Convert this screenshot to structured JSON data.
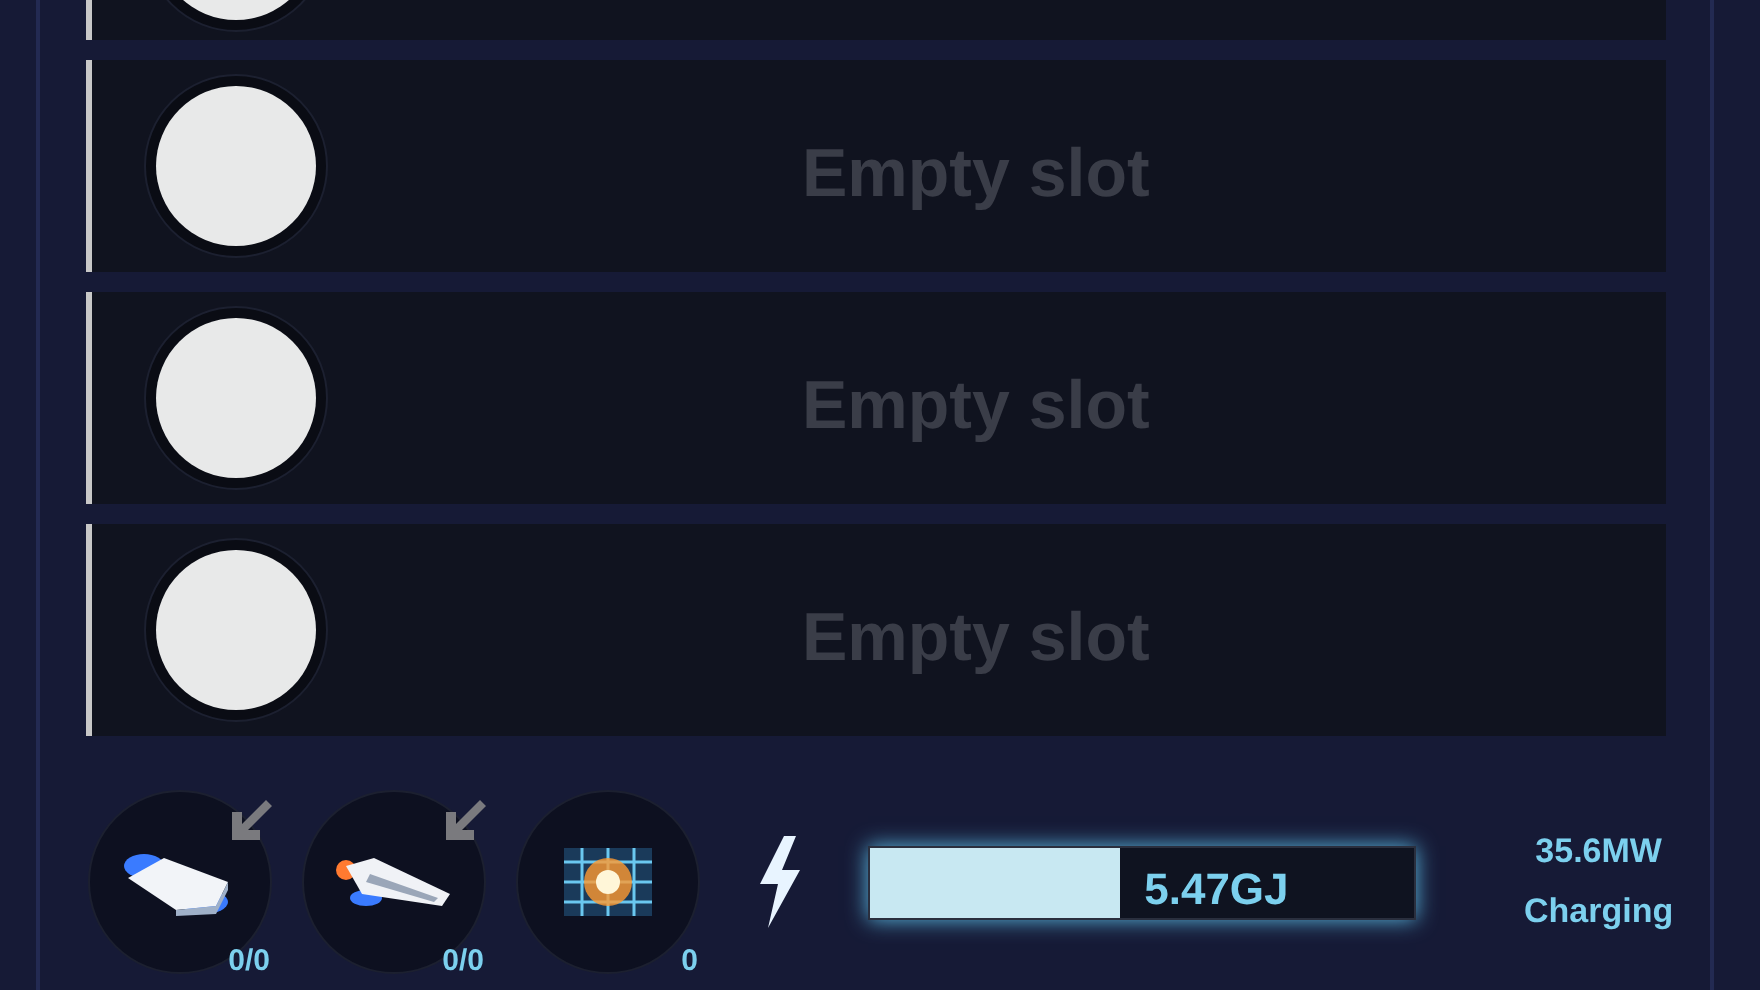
{
  "slots": [
    {
      "kind": "partial"
    },
    {
      "kind": "empty",
      "label": "Empty slot"
    },
    {
      "kind": "empty",
      "label": "Empty slot"
    },
    {
      "kind": "empty",
      "label": "Empty slot"
    }
  ],
  "modules": [
    {
      "kind": "shuttle",
      "count": "0/0",
      "arrow": true
    },
    {
      "kind": "ship",
      "count": "0/0",
      "arrow": true
    },
    {
      "kind": "burst",
      "count": "0",
      "arrow": false
    }
  ],
  "energy": {
    "level": 0.46,
    "value": "5.47GJ"
  },
  "power": {
    "rate": "35.6MW",
    "status": "Charging"
  }
}
